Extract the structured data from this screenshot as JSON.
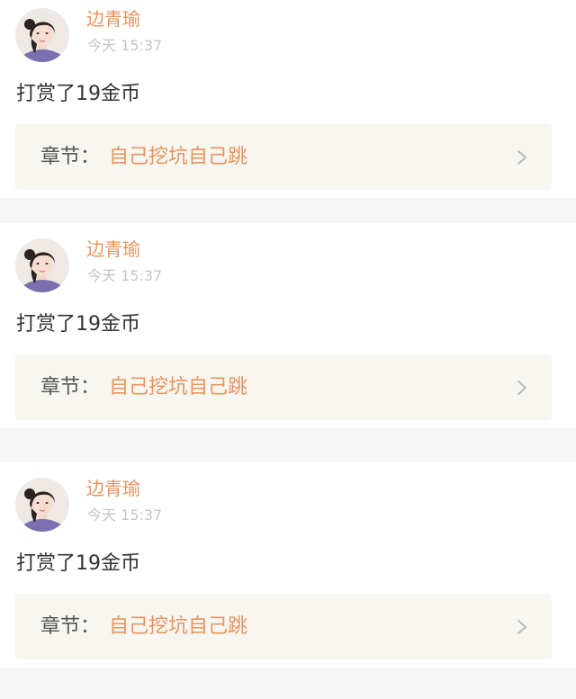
{
  "colors": {
    "accent": "#e8945c",
    "text": "#333333",
    "muted": "#c4c4c4",
    "chapter_bg": "#f7f6f1",
    "page_bg": "#f6f6f6"
  },
  "items": [
    {
      "username": "边青瑜",
      "time": "今天 15:37",
      "message": "打赏了19金币",
      "chapter_prefix": "章节：",
      "chapter_title": "自己挖坑自己跳",
      "avatar_icon": "user-avatar",
      "chevron_icon": "chevron-right-icon"
    },
    {
      "username": "边青瑜",
      "time": "今天 15:37",
      "message": "打赏了19金币",
      "chapter_prefix": "章节：",
      "chapter_title": "自己挖坑自己跳",
      "avatar_icon": "user-avatar",
      "chevron_icon": "chevron-right-icon"
    },
    {
      "username": "边青瑜",
      "time": "今天 15:37",
      "message": "打赏了19金币",
      "chapter_prefix": "章节：",
      "chapter_title": "自己挖坑自己跳",
      "avatar_icon": "user-avatar",
      "chevron_icon": "chevron-right-icon"
    }
  ]
}
